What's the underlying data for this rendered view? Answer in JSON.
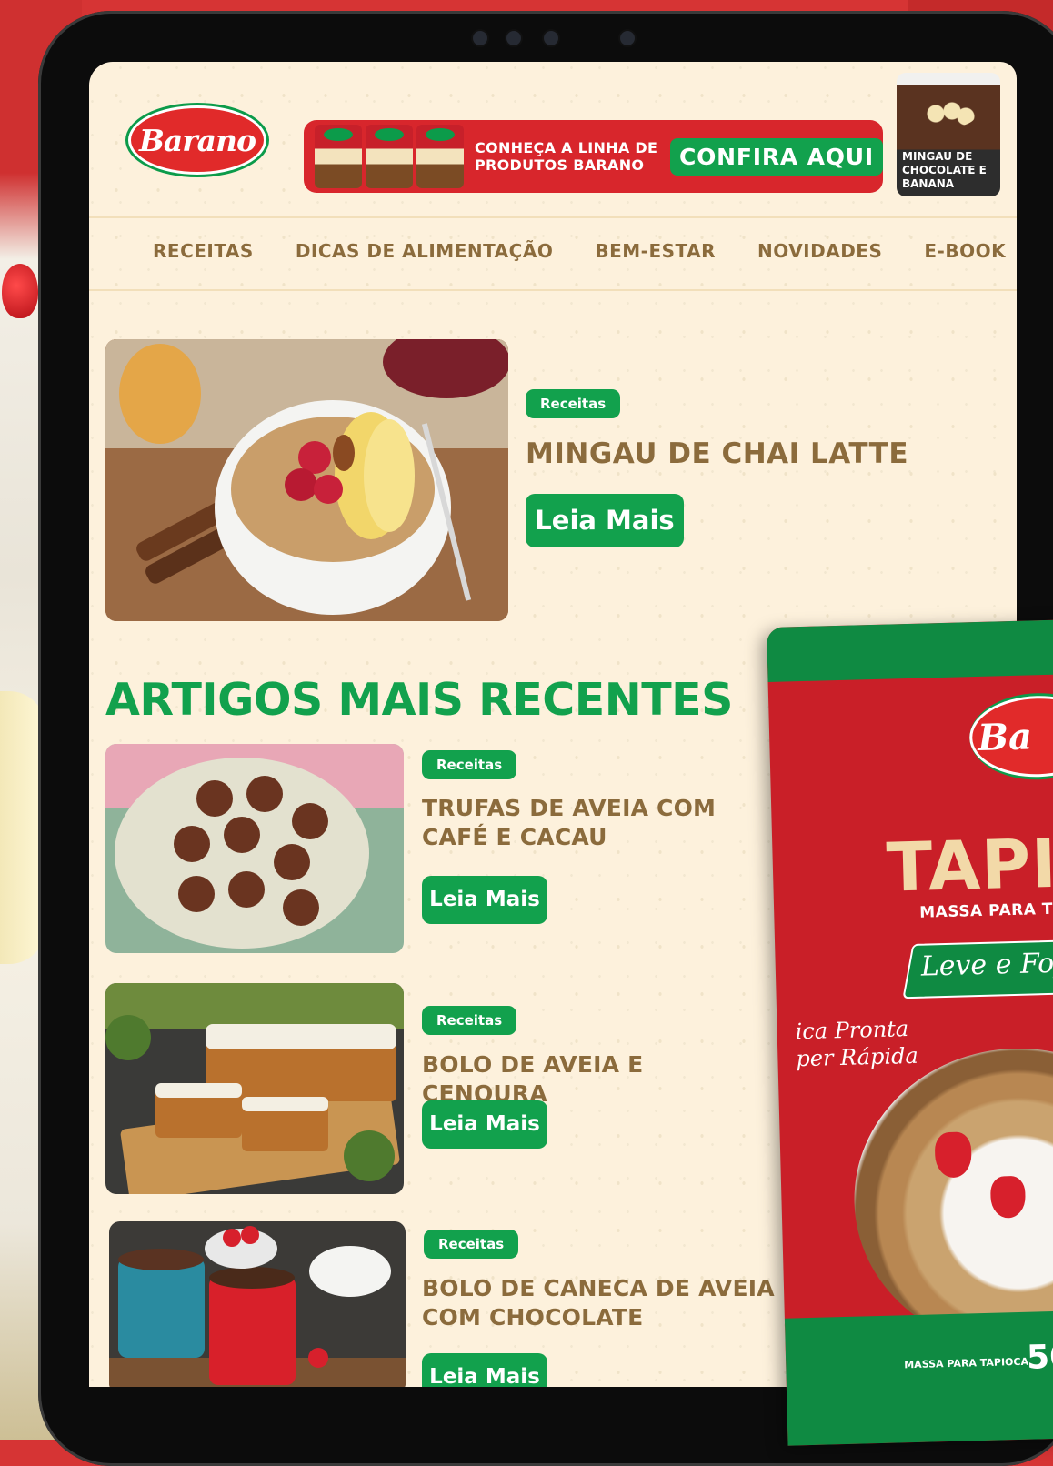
{
  "brand": {
    "logo_text": "Barano"
  },
  "header": {
    "banner_text": "CONHEÇA A LINHA DE PRODUTOS BARANO",
    "banner_button": "CONFIRA AQUI",
    "thumb_caption": "MINGAU DE CHOCOLATE E BANANA"
  },
  "nav": {
    "items": [
      "RECEITAS",
      "DICAS DE ALIMENTAÇÃO",
      "BEM-ESTAR",
      "NOVIDADES",
      "E-BOOK"
    ]
  },
  "featured": {
    "tag": "Receitas",
    "title": "MINGAU DE CHAI LATTE",
    "button": "Leia Mais"
  },
  "recent": {
    "title": "ARTIGOS MAIS RECENTES",
    "articles": [
      {
        "tag": "Receitas",
        "title": "TRUFAS DE AVEIA COM CAFÉ E CACAU",
        "button": "Leia Mais"
      },
      {
        "tag": "Receitas",
        "title": "BOLO DE AVEIA E CENOURA",
        "button": "Leia Mais"
      },
      {
        "tag": "Receitas",
        "title": "BOLO DE CANECA DE AVEIA COM CHOCOLATE",
        "button": "Leia Mais"
      }
    ]
  },
  "product": {
    "logo_text": "Ba",
    "brand": "TAPI",
    "subtitle": "MASSA PARA T",
    "ribbon": "Leve e Fof",
    "note_line1": "ica Pronta",
    "note_line2": "per Rápida",
    "footer": "MASSA PARA TAPIOCA",
    "weight": "50"
  },
  "colors": {
    "green": "#12a14d",
    "red": "#d63434",
    "brown": "#8b6b3c",
    "cream": "#fdf1dc"
  }
}
